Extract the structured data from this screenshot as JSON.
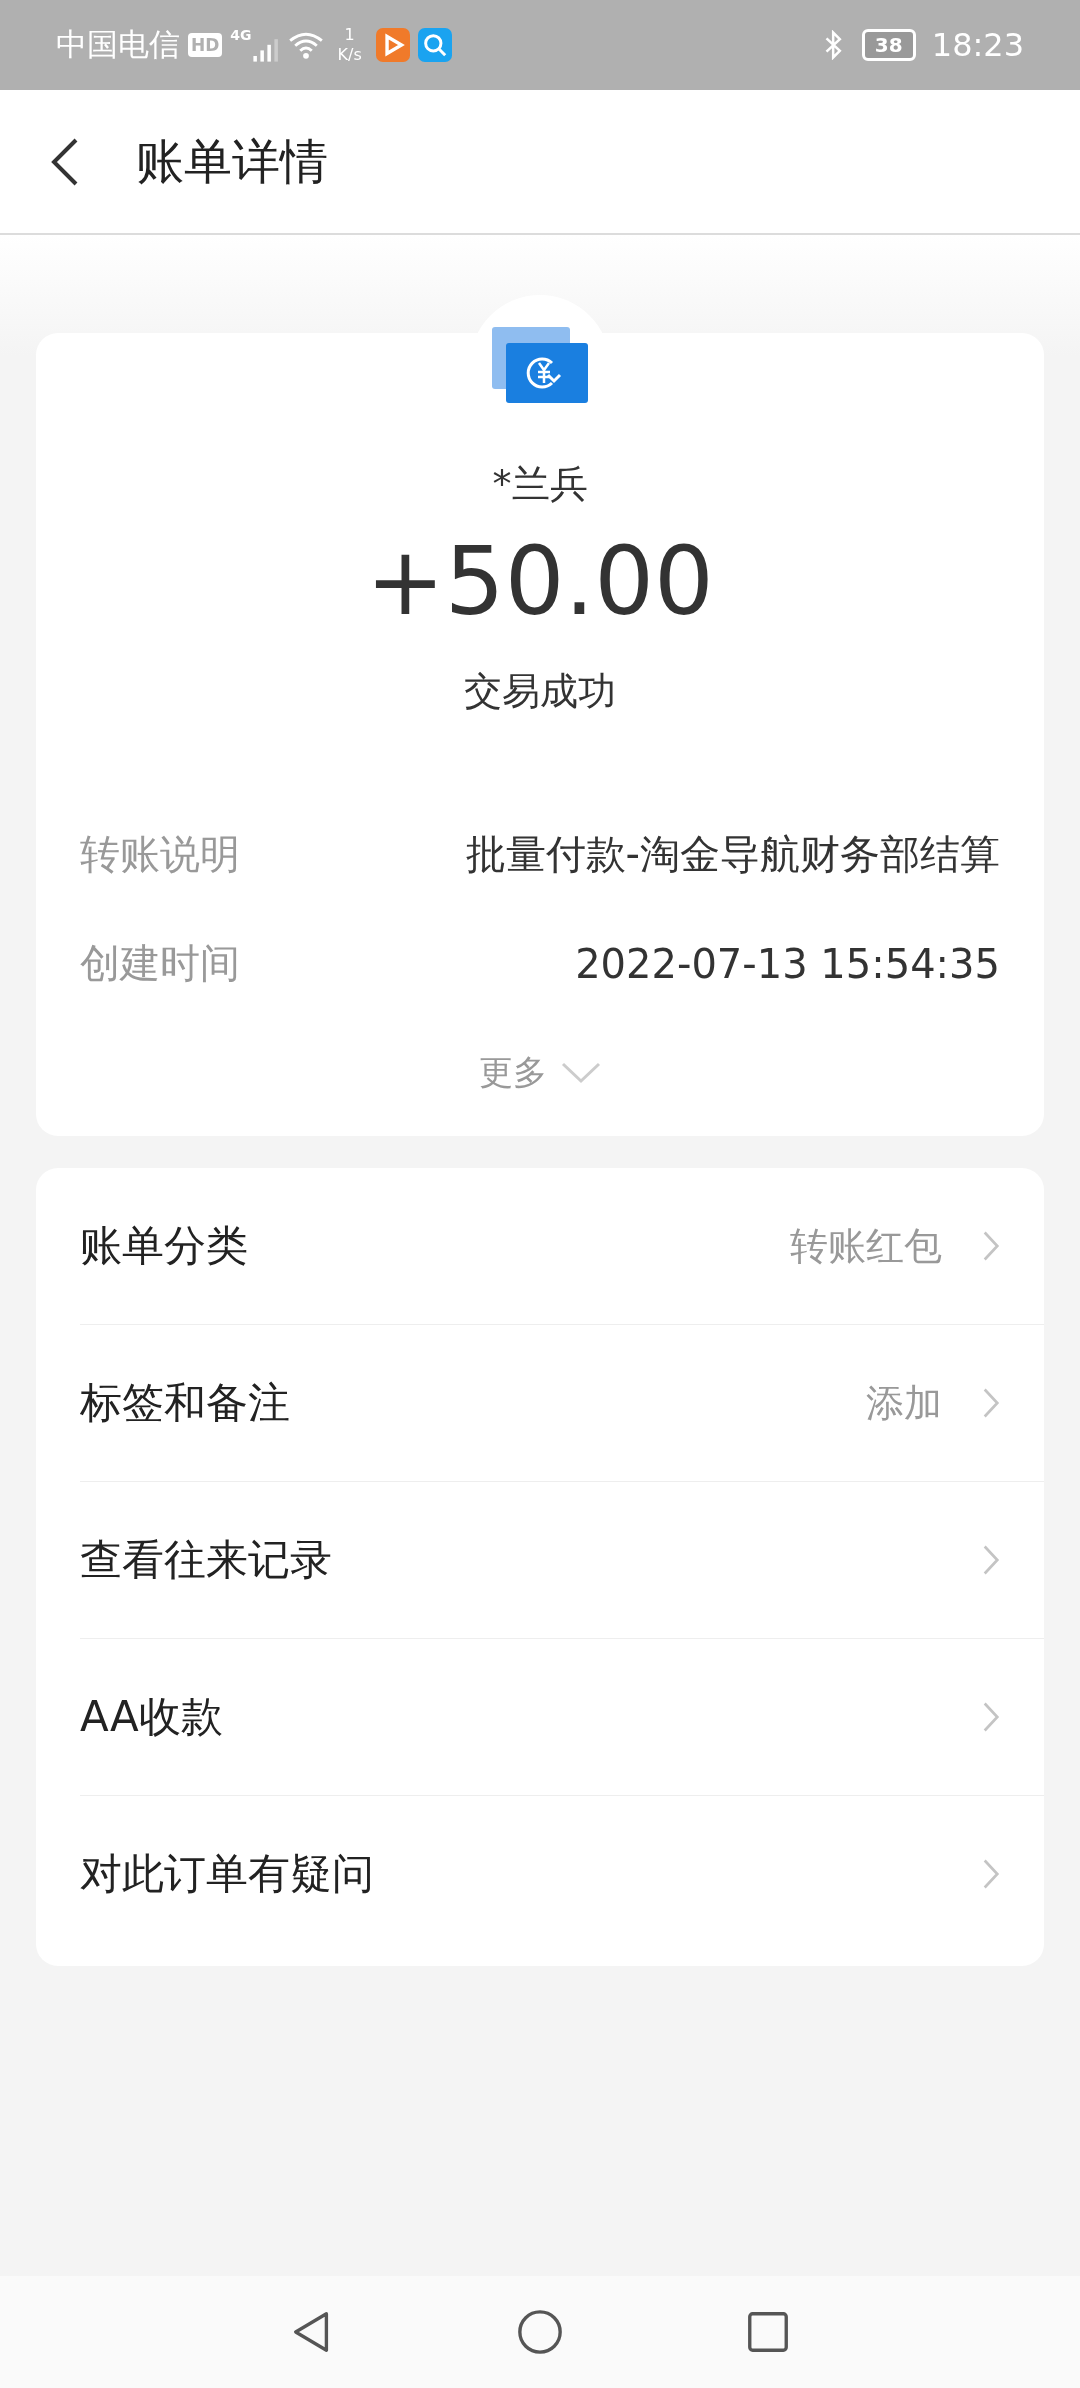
{
  "status_bar": {
    "carrier": "中国电信",
    "hd": "HD",
    "network": "4G",
    "speed_value": "1",
    "speed_unit": "K/s",
    "battery": "38",
    "time": "18:23"
  },
  "header": {
    "title": "账单详情"
  },
  "summary": {
    "name": "*兰兵",
    "amount": "+50.00",
    "status": "交易成功",
    "details": [
      {
        "label": "转账说明",
        "value": "批量付款-淘金导航财务部结算"
      },
      {
        "label": "创建时间",
        "value": "2022-07-13 15:54:35"
      }
    ],
    "more": "更多"
  },
  "menu": [
    {
      "label": "账单分类",
      "value": "转账红包"
    },
    {
      "label": "标签和备注",
      "value": "添加"
    },
    {
      "label": "查看往来记录"
    },
    {
      "label": "AA收款"
    },
    {
      "label": "对此订单有疑问"
    }
  ]
}
